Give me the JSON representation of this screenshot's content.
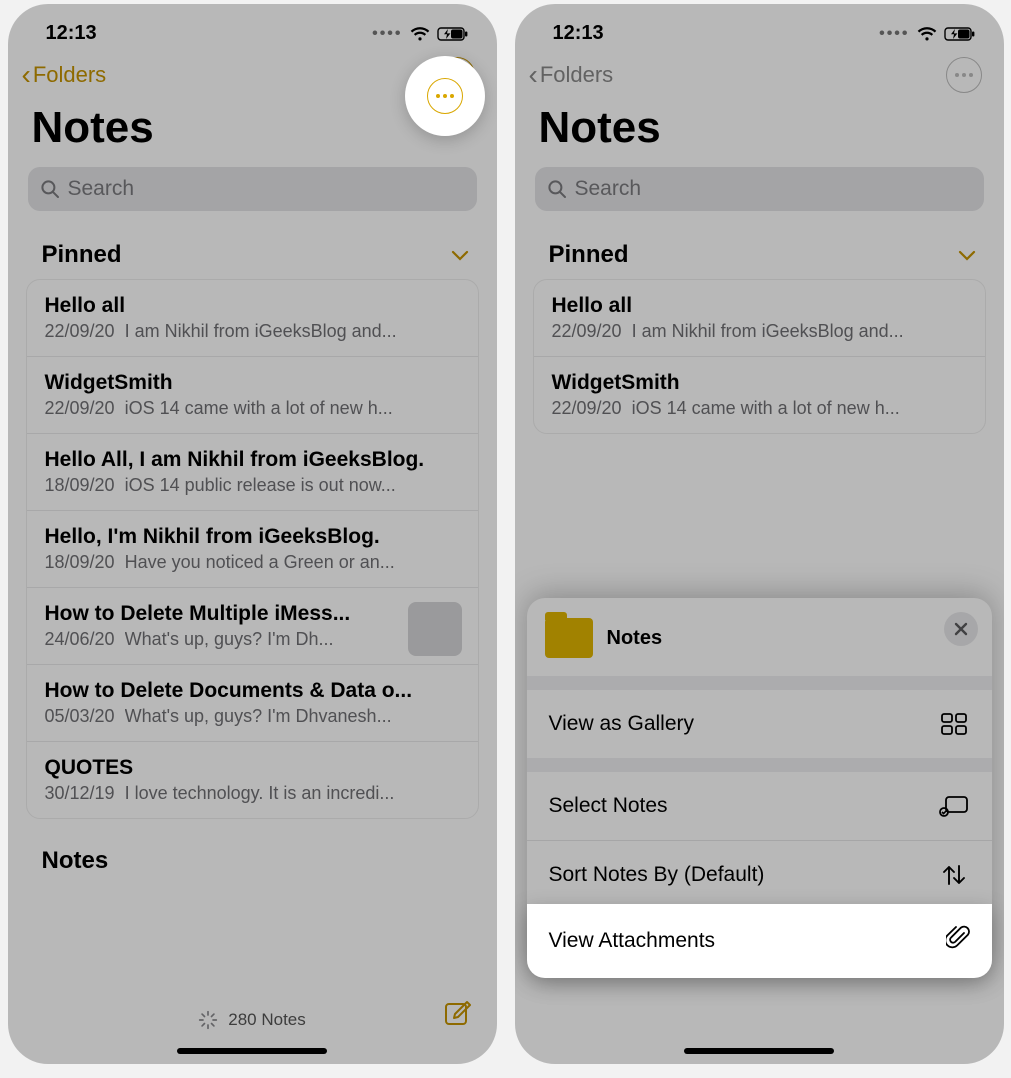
{
  "status": {
    "time": "12:13"
  },
  "navbar": {
    "back_label": "Folders"
  },
  "page_title": "Notes",
  "search_placeholder": "Search",
  "pinned_header": "Pinned",
  "notes_section_header": "Notes",
  "pinned": [
    {
      "title": "Hello all",
      "date": "22/09/20",
      "preview": "I am Nikhil from iGeeksBlog and..."
    },
    {
      "title": "WidgetSmith",
      "date": "22/09/20",
      "preview": "iOS 14 came with a lot of new h..."
    },
    {
      "title": "Hello All, I am Nikhil from iGeeksBlog.",
      "date": "18/09/20",
      "preview": "iOS 14 public release is out now..."
    },
    {
      "title": "Hello, I'm Nikhil from iGeeksBlog.",
      "date": "18/09/20",
      "preview": "Have you noticed a Green or an..."
    },
    {
      "title": "How to Delete Multiple iMess...",
      "date": "24/06/20",
      "preview": "What's up, guys? I'm Dh...",
      "has_thumb": true
    },
    {
      "title": "How to Delete Documents & Data o...",
      "date": "05/03/20",
      "preview": "What's up, guys? I'm Dhvanesh..."
    },
    {
      "title": "QUOTES",
      "date": "30/12/19",
      "preview": "I love technology. It is an incredi..."
    }
  ],
  "bottom_count": "280 Notes",
  "sheet": {
    "folder_name": "Notes",
    "items": {
      "gallery": "View as Gallery",
      "select": "Select Notes",
      "sort": "Sort Notes By (Default)",
      "attach": "View Attachments"
    }
  },
  "colors": {
    "accent": "#c59400"
  }
}
